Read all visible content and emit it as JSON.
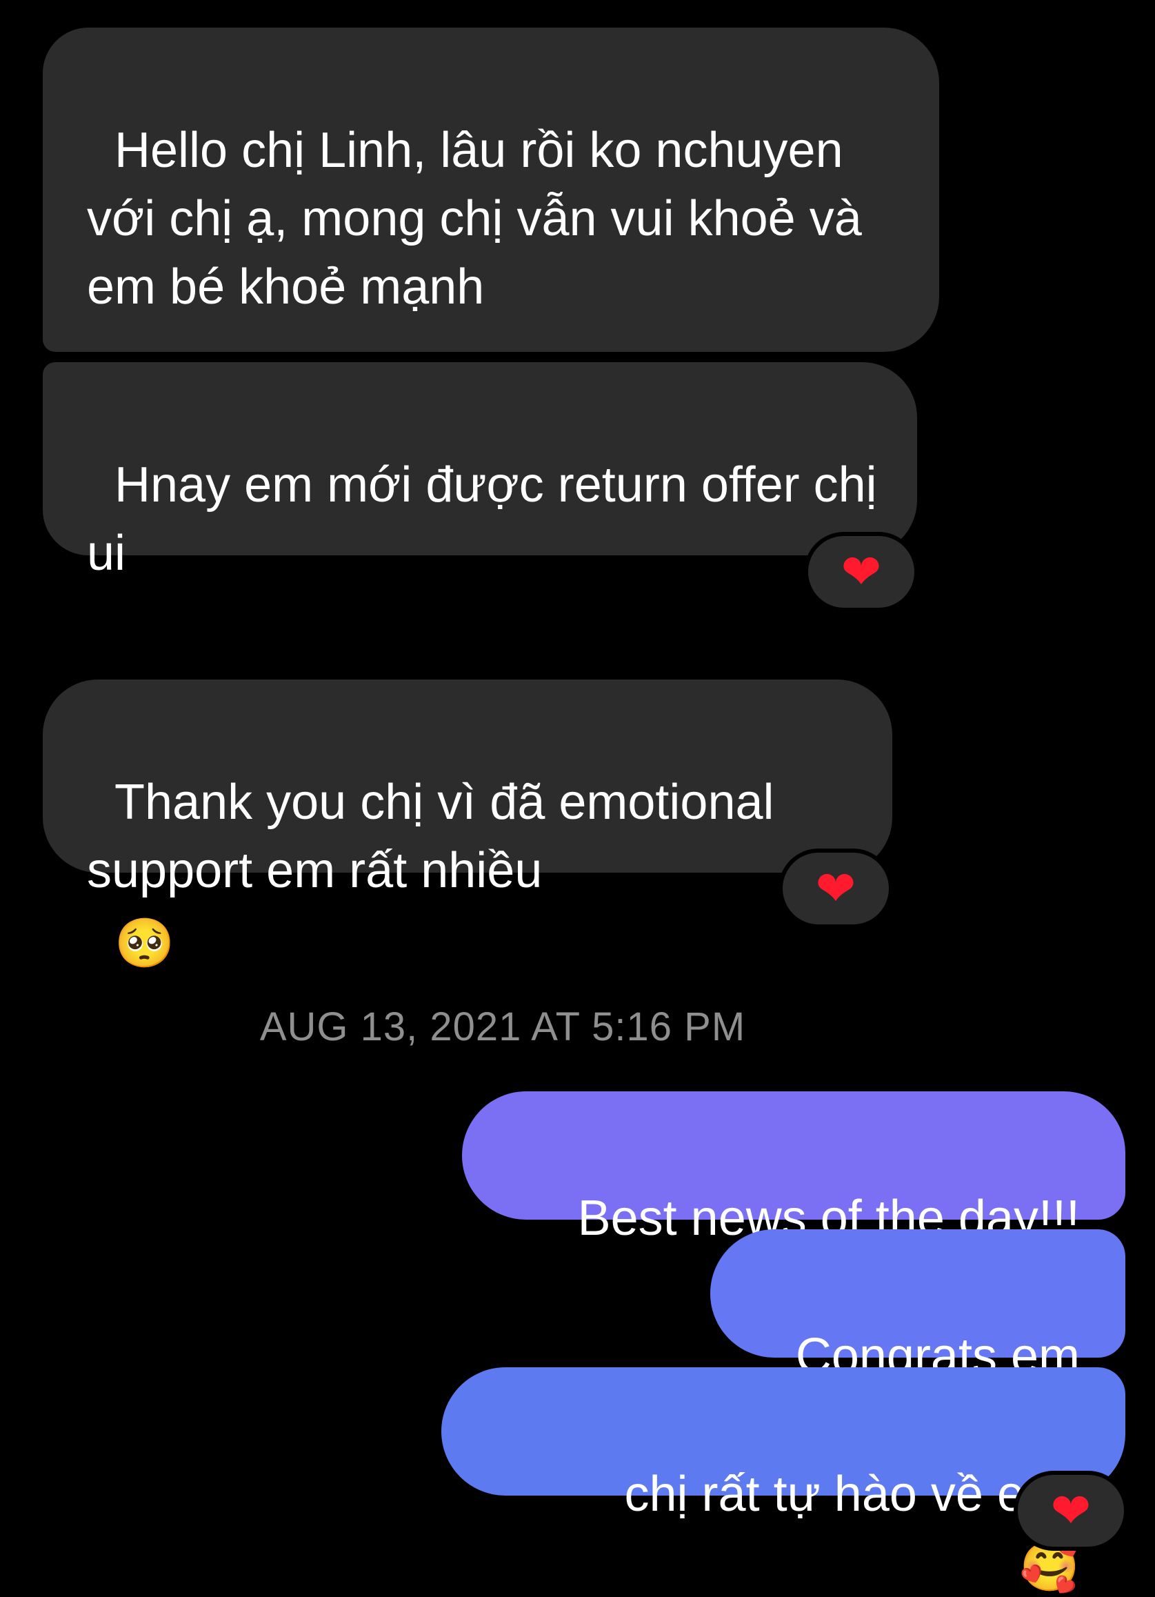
{
  "incoming_messages": [
    {
      "text": "Hello chị Linh, lâu rồi ko nchuyen với chị ạ, mong chị vẫn vui khoẻ và em bé khoẻ mạnh",
      "emoji": "🥰"
    },
    {
      "text": "Hnay em mới được return offer chị ui",
      "reaction": "❤"
    },
    {
      "text": "Thank you chị vì đã emotional support em rất nhiều",
      "emoji": "🥺",
      "reaction": "❤"
    }
  ],
  "timestamp": "AUG 13, 2021 AT 5:16 PM",
  "outgoing_messages": [
    {
      "text": "Best news of the day!!!"
    },
    {
      "text": "Congrats em"
    },
    {
      "text": "chị rất tự hào về em,",
      "emoji": "🥰",
      "reaction": "❤"
    }
  ],
  "colors": {
    "background": "#000000",
    "incoming_bubble": "#2c2c2c",
    "outgoing_gradient_top": "#7b70f4",
    "outgoing_gradient_bottom": "#5a7bf0",
    "timestamp_text": "#8f8f8f",
    "reaction_heart": "#ff1a2e"
  }
}
